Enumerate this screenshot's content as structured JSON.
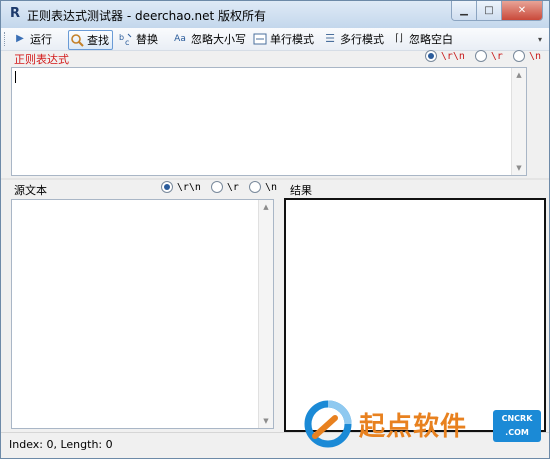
{
  "window": {
    "icon_letter": "R",
    "title": "正则表达式测试器 - deerchao.net 版权所有",
    "minimize_glyph": "▁",
    "maximize_glyph": "□",
    "close_glyph": "✕"
  },
  "toolbar": {
    "items": [
      {
        "label": "运行",
        "icon": "run-icon",
        "glyph": "▶"
      },
      {
        "label": "查找",
        "icon": "find-icon",
        "glyph": "🔍"
      },
      {
        "label": "替换",
        "icon": "replace-icon",
        "glyph": "↹"
      },
      {
        "label": "忽略大小写",
        "icon": "ignore-case-icon",
        "glyph": "Aa"
      },
      {
        "label": "单行模式",
        "icon": "single-line-icon",
        "glyph": "▭"
      },
      {
        "label": "多行模式",
        "icon": "multi-line-icon",
        "glyph": "☰"
      },
      {
        "label": "忽略空白",
        "icon": "ignore-whitespace-icon",
        "glyph": "⌈⌋"
      }
    ],
    "overflow_glyph": "▾"
  },
  "regex": {
    "label": "正则表达式",
    "value": "",
    "newline_options": [
      "\\r\\n",
      "\\r",
      "\\n"
    ],
    "selected_newline": "\\r\\n"
  },
  "source": {
    "label": "源文本",
    "value": "",
    "newline_options": [
      "\\r\\n",
      "\\r",
      "\\n"
    ],
    "selected_newline": "\\r\\n"
  },
  "result": {
    "label": "结果",
    "value": ""
  },
  "scroll": {
    "up_glyph": "▲",
    "down_glyph": "▼"
  },
  "status": {
    "text": "Index: 0, Length: 0"
  },
  "watermark": {
    "text": "起点软件",
    "badge_line1": "CNCRK",
    "badge_line2": ".COM"
  },
  "colors": {
    "regex_label": "#d31a1a",
    "watermark_orange": "#e8811f",
    "watermark_blue": "#1b8ad6"
  }
}
